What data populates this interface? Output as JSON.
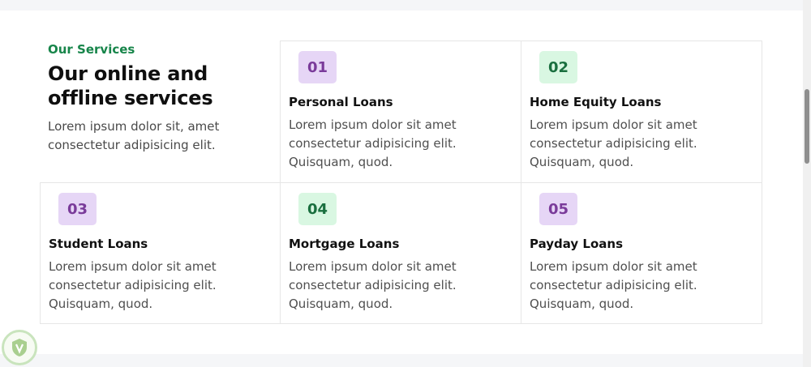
{
  "section": {
    "eyebrow": "Our Services",
    "heading": "Our online and offline services",
    "intro": "Lorem ipsum dolor sit, amet consectetur adipisicing elit."
  },
  "services": [
    {
      "number": "01",
      "title": "Personal Loans",
      "text": "Lorem ipsum dolor sit amet consectetur adipisicing elit. Quisquam, quod.",
      "accent": "#e6d6f6"
    },
    {
      "number": "02",
      "title": "Home Equity Loans",
      "text": "Lorem ipsum dolor sit amet consectetur adipisicing elit. Quisquam, quod.",
      "accent": "#d9f7e2"
    },
    {
      "number": "03",
      "title": "Student Loans",
      "text": "Lorem ipsum dolor sit amet consectetur adipisicing elit. Quisquam, quod.",
      "accent": "#e6d6f6"
    },
    {
      "number": "04",
      "title": "Mortgage Loans",
      "text": "Lorem ipsum dolor sit amet consectetur adipisicing elit. Quisquam, quod.",
      "accent": "#d9f7e2"
    },
    {
      "number": "05",
      "title": "Payday Loans",
      "text": "Lorem ipsum dolor sit amet consectetur adipisicing elit. Quisquam, quod.",
      "accent": "#e6d6f6"
    }
  ],
  "colors": {
    "brand_green": "#17854a",
    "badge_purple": "#e6d6f6",
    "badge_green": "#d9f7e2"
  },
  "icons": {
    "watermark": "shield-logo-icon"
  }
}
